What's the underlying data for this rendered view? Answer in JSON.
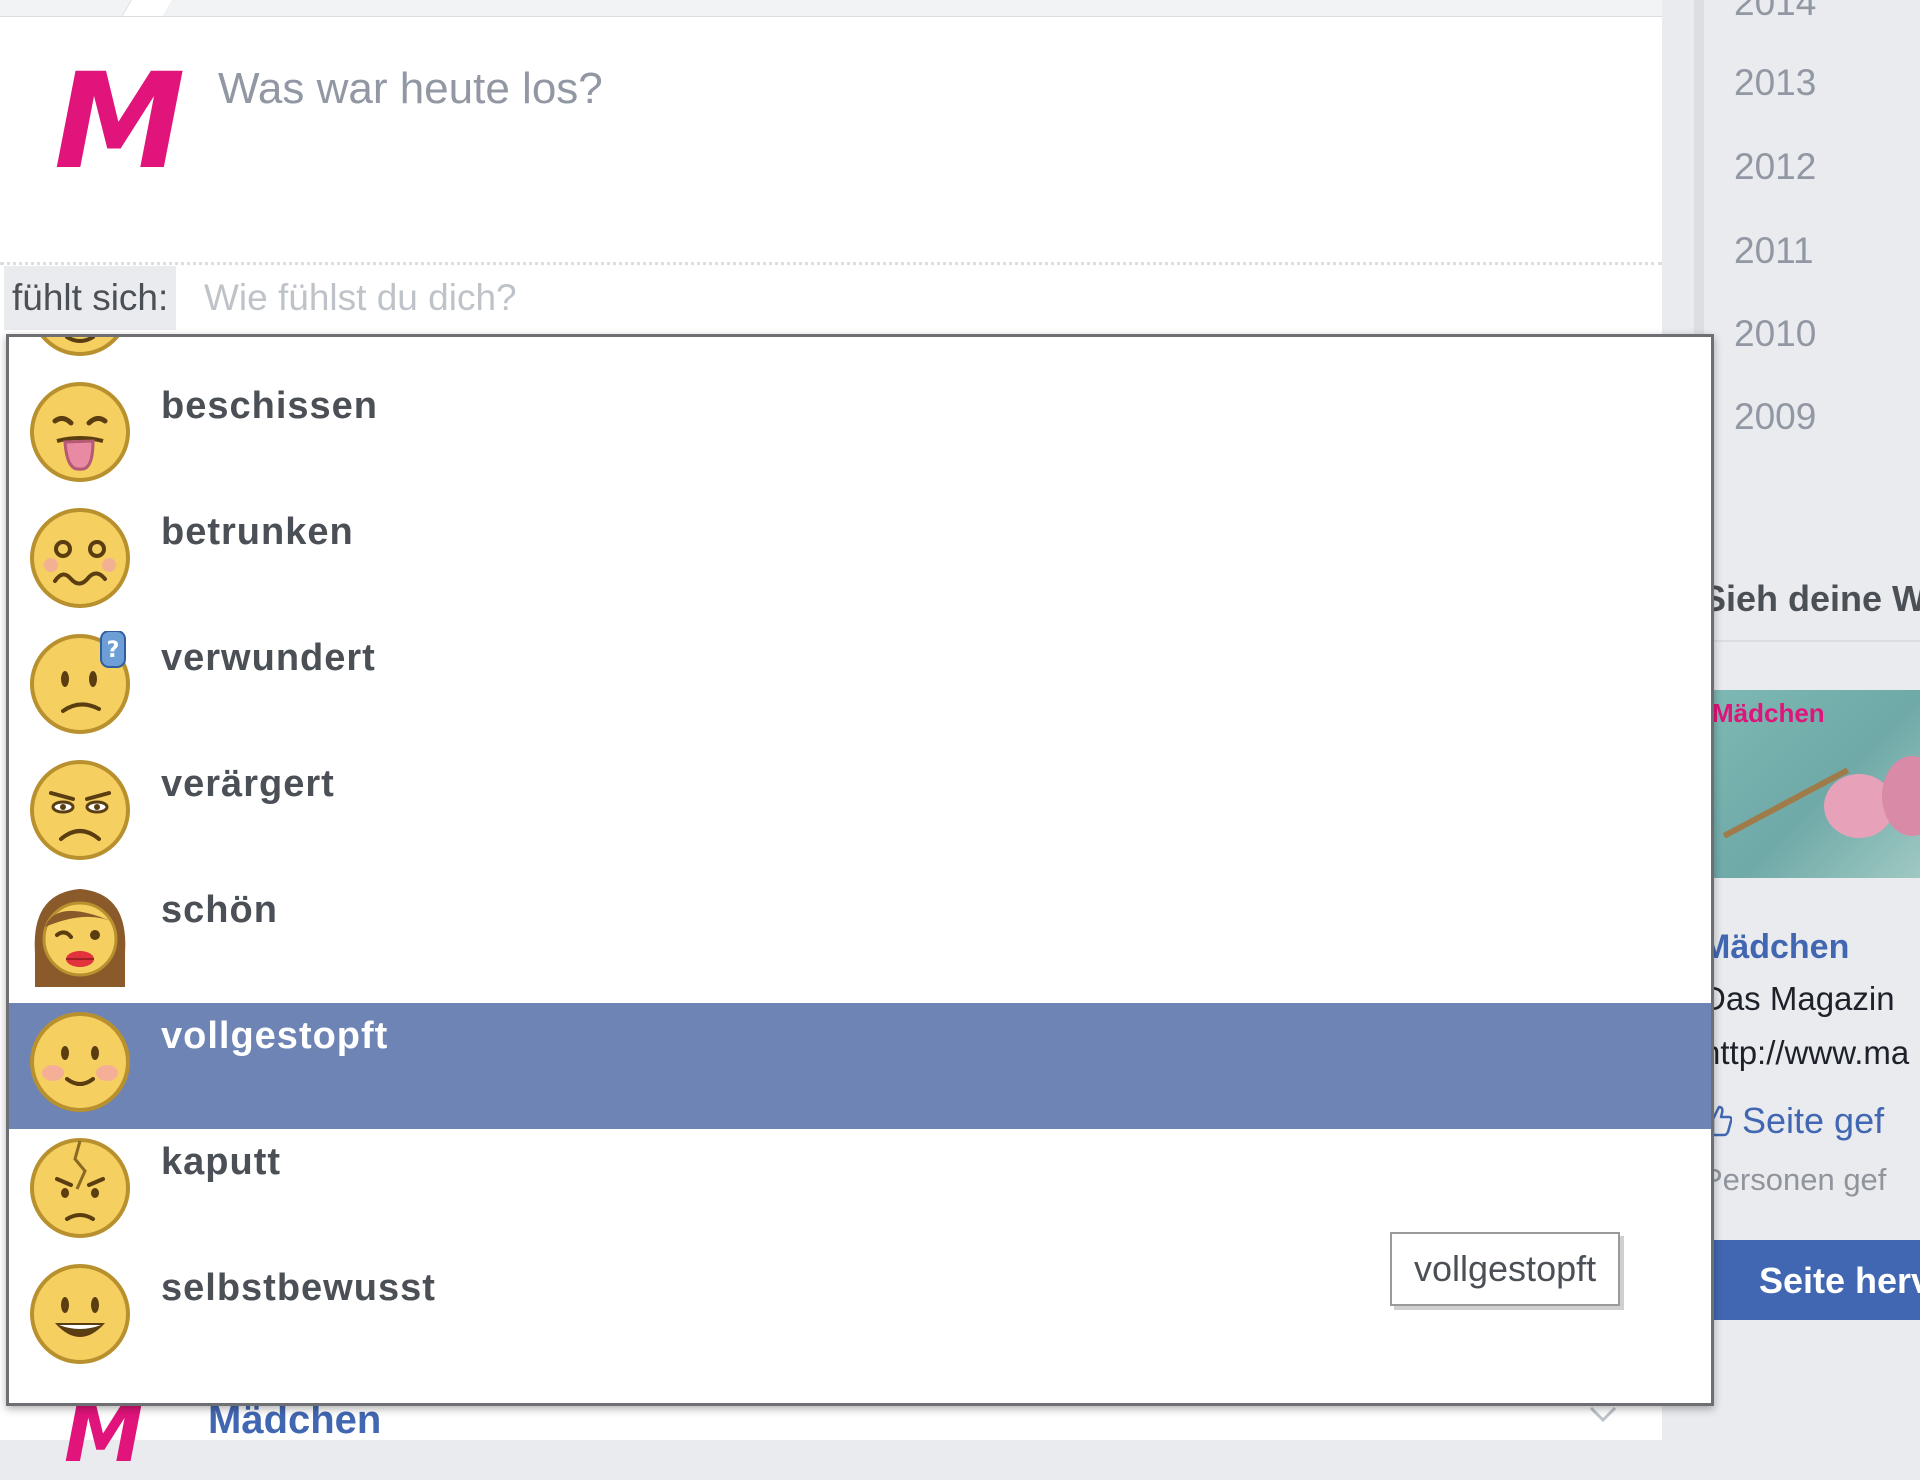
{
  "composer": {
    "logo_letter": "M",
    "status_placeholder": "Was war heute los?",
    "feeling_label": "fühlt sich:",
    "feeling_placeholder": "Wie fühlst du dich?"
  },
  "timeline_years": [
    "2014",
    "2013",
    "2012",
    "2011",
    "2010",
    "2009"
  ],
  "sidebar": {
    "see_link": "Sieh deine W",
    "page_cover_brand": "Mädchen",
    "page_name": "Mädchen",
    "page_desc": "Das Magazin",
    "page_url": "http://www.ma",
    "like_label": "Seite gef",
    "people_label": "Personen gef",
    "promote_label": "Seite herv"
  },
  "feelings": {
    "items": [
      {
        "label": "",
        "icon": "partial-smiley-icon"
      },
      {
        "label": "beschissen",
        "icon": "tongue-out-icon"
      },
      {
        "label": "betrunken",
        "icon": "drunk-face-icon"
      },
      {
        "label": "verwundert",
        "icon": "confused-face-icon"
      },
      {
        "label": "verärgert",
        "icon": "annoyed-face-icon"
      },
      {
        "label": "schön",
        "icon": "pretty-girl-icon"
      },
      {
        "label": "vollgestopft",
        "icon": "stuffed-face-icon"
      },
      {
        "label": "kaputt",
        "icon": "broken-face-icon"
      },
      {
        "label": "selbstbewusst",
        "icon": "confident-face-icon"
      }
    ],
    "selected": "vollgestopft",
    "tooltip": "vollgestopft"
  },
  "below_post": {
    "logo_letter": "M",
    "name": "Mädchen"
  },
  "colors": {
    "brand_pink": "#e0147a",
    "selection_blue": "#6d84b4",
    "link_blue": "#4267b2",
    "emoji_yellow": "#f5cf60"
  }
}
